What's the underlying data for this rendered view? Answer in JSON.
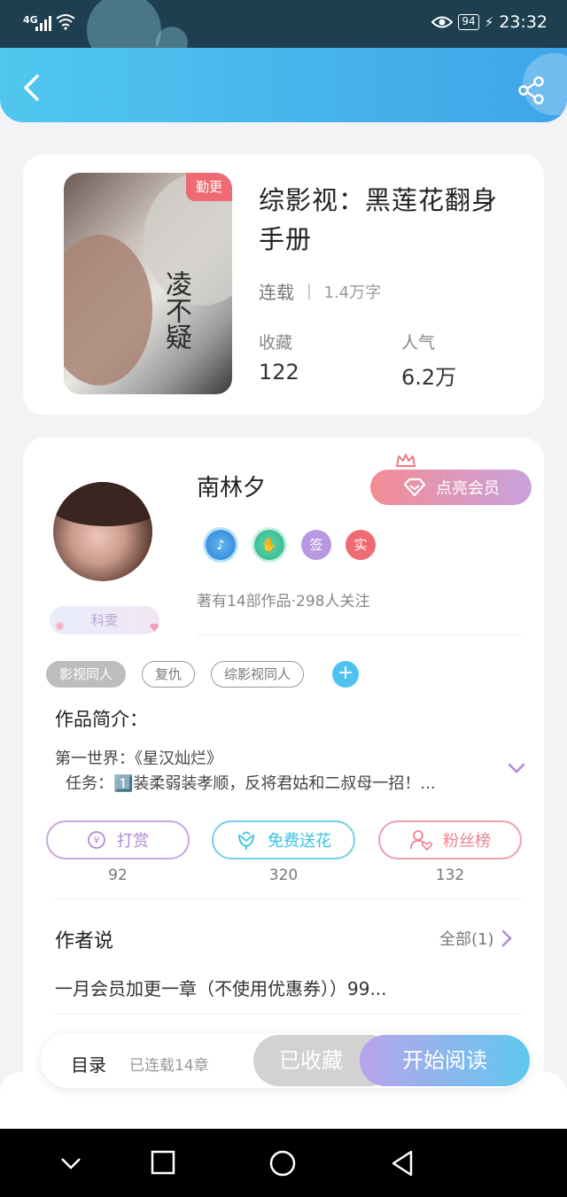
{
  "status_bar": {
    "network": "4G",
    "battery": "94",
    "time": "23:32"
  },
  "book": {
    "cover_tag": "勤更",
    "cover_calligraphy": "凌不疑",
    "title": "综影视：黑莲花翻身手册",
    "status": "连载",
    "word_count": "1.4万字",
    "favorites_label": "收藏",
    "favorites_value": "122",
    "popularity_label": "人气",
    "popularity_value": "6.2万"
  },
  "author": {
    "name": "南林夕",
    "badge": "科雯",
    "vip_label": "点亮会员",
    "honor_sign": "签",
    "honor_real": "实",
    "stats": "著有14部作品·298人关注"
  },
  "tags": [
    "影视同人",
    "复仇",
    "综影视同人"
  ],
  "intro": {
    "heading": "作品简介：",
    "line1": "第一世界：《星汉灿烂》",
    "line2": "任务：1️⃣装柔弱装孝顺，反将君姑和二叔母一招！..."
  },
  "actions": [
    {
      "label": "打赏",
      "count": "92"
    },
    {
      "label": "免费送花",
      "count": "320"
    },
    {
      "label": "粉丝榜",
      "count": "132"
    }
  ],
  "author_says": {
    "heading": "作者说",
    "all_label": "全部(1)",
    "text": "一月会员加更一章（不使用优惠券））99..."
  },
  "bottom_bar": {
    "toc_label": "目录",
    "toc_sub": "已连载14章",
    "collected_label": "已收藏",
    "read_label": "开始阅读"
  },
  "colors": {
    "header": "#50c7ef",
    "tip": "#b08ad8",
    "flower": "#38c3e6",
    "fans": "#ee8090",
    "vip": "#f38c93"
  }
}
